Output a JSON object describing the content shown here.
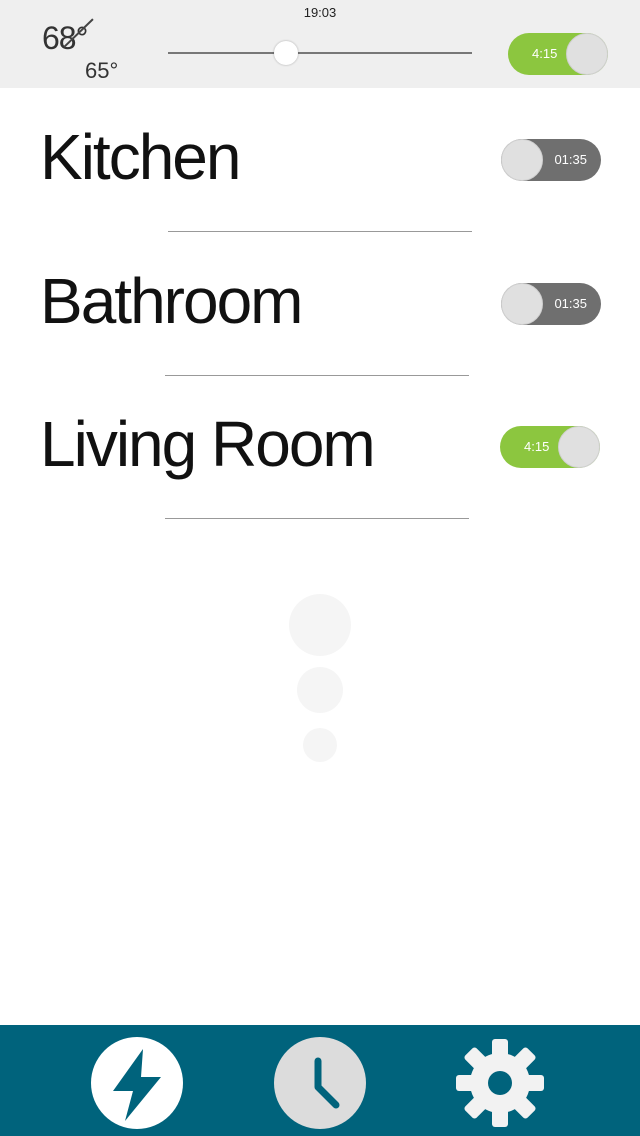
{
  "status_bar": {
    "time": "19:03"
  },
  "header": {
    "temperature_current": "68°",
    "temperature_target": "65°",
    "slider_value_percent": 38,
    "timer_toggle": {
      "label": "4:15",
      "state": "on"
    }
  },
  "rooms": [
    {
      "name": "Kitchen",
      "timer": "01:35",
      "state": "off"
    },
    {
      "name": "Bathroom",
      "timer": "01:35",
      "state": "off"
    },
    {
      "name": "Living Room",
      "timer": "4:15",
      "state": "on"
    }
  ],
  "tabbar": {
    "tabs": [
      {
        "icon": "lightning-icon",
        "active": true
      },
      {
        "icon": "clock-icon",
        "active": false
      },
      {
        "icon": "gear-icon",
        "active": false
      }
    ]
  },
  "colors": {
    "accent_green": "#8cc63f",
    "toggle_off": "#6f6f6f",
    "tabbar_bg": "#00637c",
    "header_bg": "#efefef"
  }
}
